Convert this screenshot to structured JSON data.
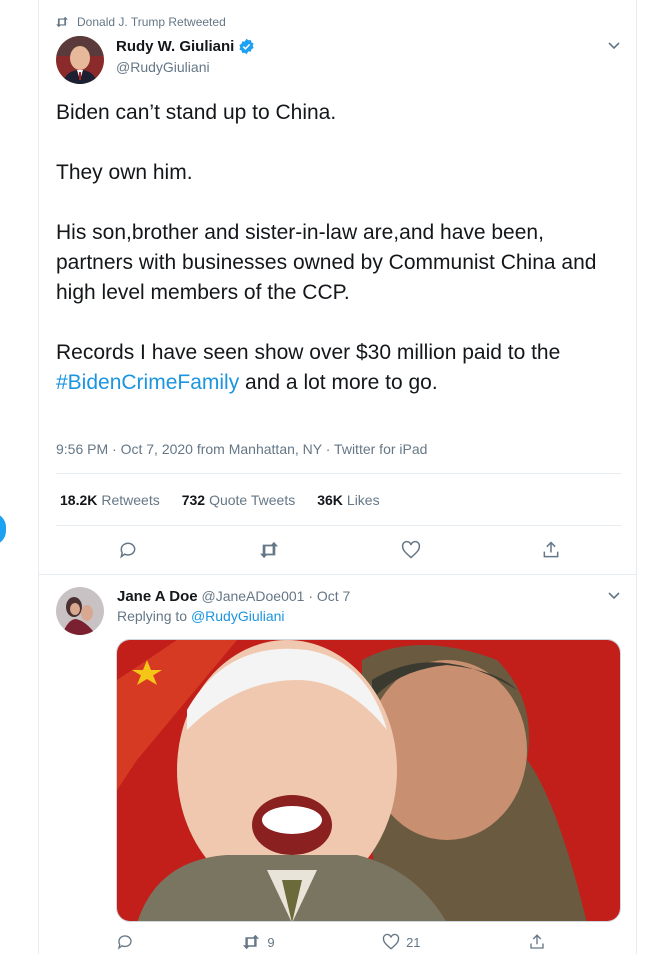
{
  "retweet_label": "Donald J. Trump Retweeted",
  "tweet": {
    "author_name": "Rudy W. Giuliani",
    "author_handle": "@RudyGiuliani",
    "verified": true,
    "paragraphs": [
      "Biden can’t stand up to China.",
      "They own him.",
      "His son,brother and sister-in-law are,and have been, partners with businesses owned by Communist China and high level members of the CCP."
    ],
    "last_paragraph_before": "Records I have seen show over $30 million paid to the ",
    "hashtag": "#BidenCrimeFamily",
    "last_paragraph_after": " and a lot more to go.",
    "meta": "9:56 PM · Oct 7, 2020 from Manhattan, NY · Twitter for iPad",
    "stats": {
      "retweets_count": "18.2K",
      "retweets_label": "Retweets",
      "quotes_count": "732",
      "quotes_label": "Quote Tweets",
      "likes_count": "36K",
      "likes_label": "Likes"
    }
  },
  "reply": {
    "author_name": "Jane A Doe",
    "author_handle": "@JaneADoe001",
    "date": "· Oct 7",
    "replying_prefix": "Replying to ",
    "replying_handle": "@RudyGiuliani",
    "retweet_count": "9",
    "like_count": "21"
  },
  "colors": {
    "accent": "#1da1f2",
    "link": "#1b95e0",
    "muted": "#657786",
    "text": "#14171a"
  },
  "icons": [
    "retweet-icon",
    "verified-badge-icon",
    "chevron-down-icon",
    "reply-icon",
    "like-icon",
    "share-icon"
  ]
}
